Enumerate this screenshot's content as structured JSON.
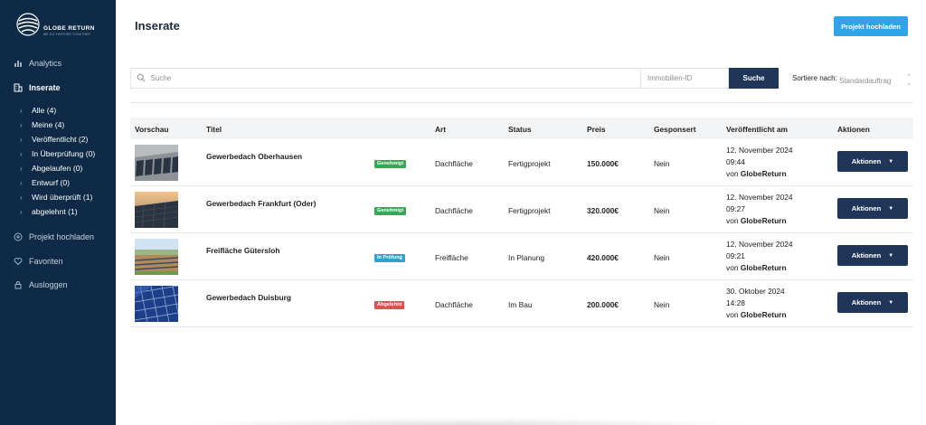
{
  "brand": {
    "name": "GLOBE RETURN",
    "tagline": "WE GO FURTHER TOGETHER"
  },
  "colors": {
    "sidebar": "#0e2a47",
    "accent": "#2fa4e8",
    "primary_button": "#1f3658",
    "badge_approved": "#3aa655",
    "badge_review": "#2fa4c8",
    "badge_rejected": "#d9534f"
  },
  "sidebar": {
    "items": [
      {
        "label": "Analytics",
        "icon": "chart-bar-icon"
      },
      {
        "label": "Inserate",
        "icon": "building-icon",
        "active": true
      },
      {
        "label": "Projekt hochladen",
        "icon": "plus-circle-icon"
      },
      {
        "label": "Favoriten",
        "icon": "heart-icon"
      },
      {
        "label": "Ausloggen",
        "icon": "lock-icon"
      }
    ],
    "sub_items": [
      {
        "label": "Alle (4)"
      },
      {
        "label": "Meine (4)"
      },
      {
        "label": "Veröffentlicht (2)"
      },
      {
        "label": "In Überprüfung (0)"
      },
      {
        "label": "Abgelaufen (0)"
      },
      {
        "label": "Entwurf (0)"
      },
      {
        "label": "Wird überprüft (1)"
      },
      {
        "label": "abgelehnt (1)"
      }
    ]
  },
  "header": {
    "title": "Inserate",
    "upload_label": "Projekt hochladen"
  },
  "search": {
    "placeholder": "Suche",
    "id_placeholder": "Immobilien-ID",
    "button_label": "Suche",
    "sort_label": "Sortiere nach:",
    "sort_value": "Standardauftrag"
  },
  "table": {
    "columns": [
      "Vorschau",
      "Titel",
      "Art",
      "Status",
      "Preis",
      "Gesponsert",
      "Veröffentlicht am",
      "Aktionen"
    ],
    "rows": [
      {
        "title": "Gewerbedach Oberhausen",
        "badge": "Genehmigt",
        "art": "Dachfläche",
        "status": "Fertigprojekt",
        "preis": "150.000€",
        "gesponsert": "Nein",
        "date": "12. November 2024",
        "time": "09:44",
        "by_prefix": "von",
        "by": "GlobeReturn",
        "action": "Aktionen"
      },
      {
        "title": "Gewerbedach Frankfurt (Oder)",
        "badge": "Genehmigt",
        "art": "Dachfläche",
        "status": "Fertigprojekt",
        "preis": "320.000€",
        "gesponsert": "Nein",
        "date": "12. November 2024",
        "time": "09:27",
        "by_prefix": "von",
        "by": "GlobeReturn",
        "action": "Aktionen"
      },
      {
        "title": "Freifläche Gütersloh",
        "badge": "In Prüfung",
        "art": "Freifläche",
        "status": "In Planung",
        "preis": "420.000€",
        "gesponsert": "Nein",
        "date": "12. November 2024",
        "time": "09:21",
        "by_prefix": "von",
        "by": "GlobeReturn",
        "action": "Aktionen"
      },
      {
        "title": "Gewerbedach Duisburg",
        "badge": "Abgelehnt",
        "art": "Dachfläche",
        "status": "Im Bau",
        "preis": "200.000€",
        "gesponsert": "Nein",
        "date": "30. Oktober 2024",
        "time": "14:28",
        "by_prefix": "von",
        "by": "GlobeReturn",
        "action": "Aktionen"
      }
    ]
  }
}
